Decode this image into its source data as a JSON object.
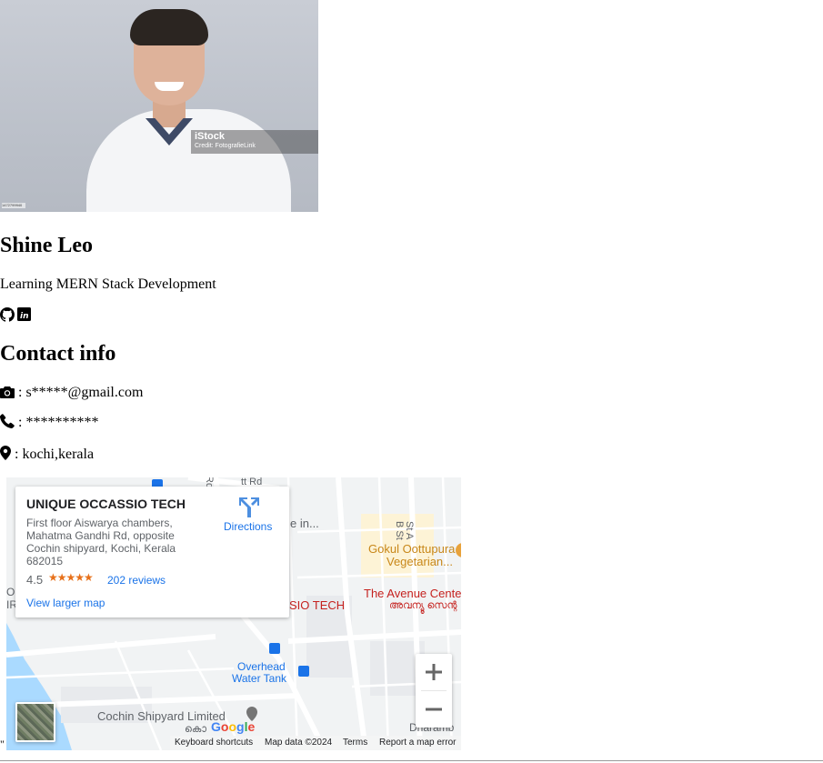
{
  "profile": {
    "photo_alt": "",
    "watermark_brand": "iStock",
    "watermark_credit": "Credit: FotografieLink",
    "image_tag": "1472799940",
    "name": "Shine Leo",
    "tagline": "Learning MERN Stack Development",
    "social_icons": [
      "github-icon",
      "linkedin-icon"
    ]
  },
  "contact": {
    "title": "Contact info",
    "email_icon": "camera-icon",
    "email": ": s*****@gmail.com",
    "phone_icon": "phone-icon",
    "phone": ": **********",
    "location_icon": "map-marker-icon",
    "location": ": kochi,kerala"
  },
  "map": {
    "business_name": "UNIQUE OCCASSIO TECH",
    "address": "First floor Aiswarya chambers, Mahatma Gandhi Rd, opposite Cochin shipyard, Kochi, Kerala 682015",
    "rating": "4.5",
    "stars_value": 4.5,
    "stars_glyphs": "★★★★★",
    "reviews": "202 reviews",
    "larger_map": "View larger map",
    "directions": "Directions",
    "labels": {
      "gokul": "Gokul Oottupura",
      "vegetarian": "Vegetarian...",
      "avenue": "The Avenue Cente",
      "avenue_ml": "അവന്യൂ സെന്റ",
      "occassio": "SIO TECH",
      "e_in": "e in...",
      "overhead": "Overhead",
      "water_tank": "Water Tank",
      "shipyard": "Cochin Shipyard Limited",
      "shipyard_ml": "കൊ",
      "ou": "OU",
      "ir": "IR",
      "dharamb": "Dharamb",
      "tt_rd": "tt Rd",
      "st_a": "St A",
      "b_st": "B St",
      "rd": "Rd"
    },
    "google": "Google",
    "attribution": {
      "keyboard": "Keyboard shortcuts",
      "data": "Map data ©2024",
      "terms": "Terms",
      "report": "Report a map error"
    },
    "zoom_in": "+",
    "zoom_out": "−",
    "colors": {
      "link": "#1a73e8",
      "poi_orange": "#c88719",
      "poi_red": "#c5221f",
      "water": "#aadaff",
      "road": "#ffffff",
      "land": "#f1f3f4"
    }
  },
  "stray_text": "\""
}
